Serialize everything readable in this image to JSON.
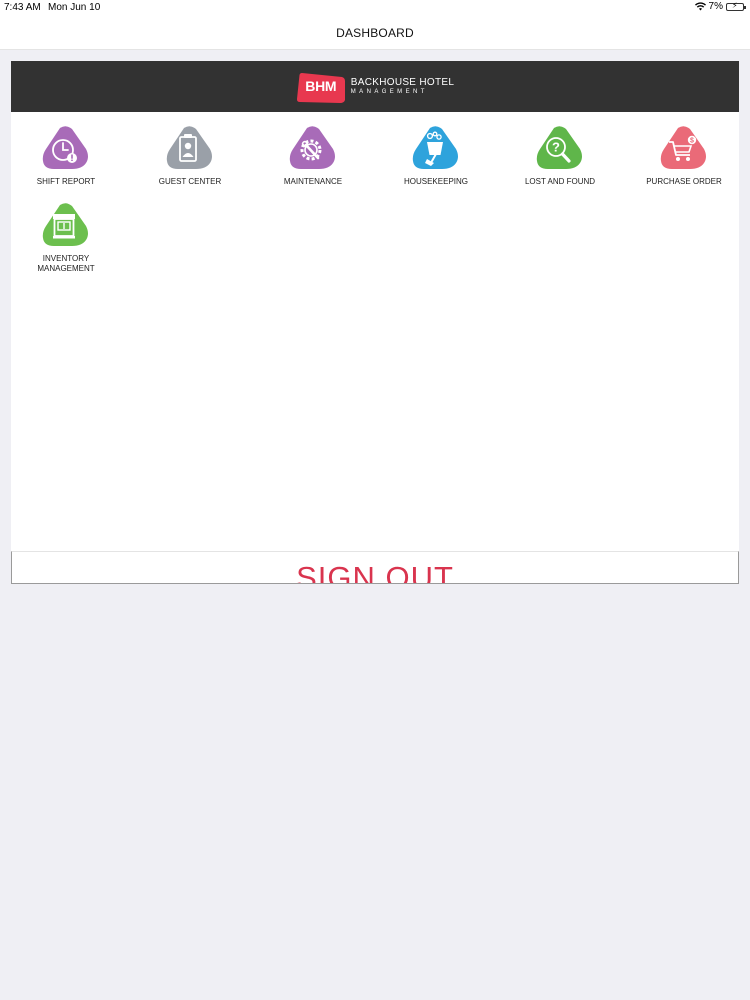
{
  "status_bar": {
    "time": "7:43 AM",
    "date": "Mon Jun 10",
    "battery_percent": "7%",
    "battery_level": 0.07
  },
  "nav": {
    "title": "DASHBOARD"
  },
  "banner": {
    "logo_mark": "BHM",
    "line1": "BACKHOUSE HOTEL",
    "line2": "MANAGEMENT",
    "background_color": "#323232",
    "logo_color": "#e8384f"
  },
  "tiles": [
    {
      "label": "SHIFT REPORT",
      "icon": "clock-alert-icon",
      "color": "#a86bb8"
    },
    {
      "label": "GUEST CENTER",
      "icon": "badge-person-icon",
      "color": "#9aa0a8"
    },
    {
      "label": "MAINTENANCE",
      "icon": "gear-wrench-icon",
      "color": "#a86bb8"
    },
    {
      "label": "HOUSEKEEPING",
      "icon": "bucket-broom-icon",
      "color": "#2ea3dc"
    },
    {
      "label": "LOST AND FOUND",
      "icon": "question-magnifier-icon",
      "color": "#5fb64a"
    },
    {
      "label": "PURCHASE ORDER",
      "icon": "cart-dollar-icon",
      "color": "#ea6a78"
    },
    {
      "label": "INVENTORY\nMANAGEMENT",
      "icon": "storefront-icon",
      "color": "#6cbf4e"
    }
  ],
  "footer": {
    "sign_out_label": "SIGN OUT",
    "sign_out_color": "#d9344e"
  }
}
